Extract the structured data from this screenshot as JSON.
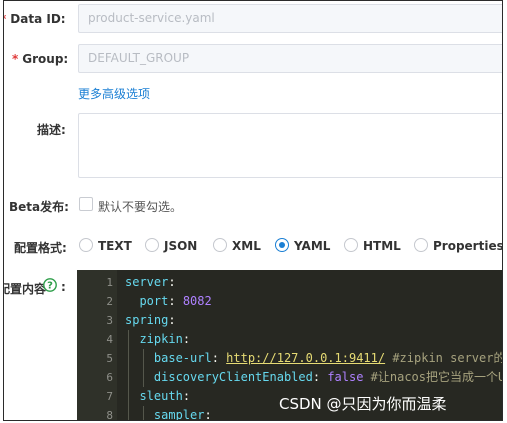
{
  "form": {
    "data_id": {
      "required_mark": "*",
      "label": "Data ID:",
      "value": "product-service.yaml"
    },
    "group": {
      "required_mark": "*",
      "label": "Group:",
      "value": "DEFAULT_GROUP"
    },
    "advanced_link": "更多高级选项",
    "description": {
      "label": "描述:",
      "value": ""
    },
    "beta": {
      "label": "Beta发布:",
      "checkbox_label": "默认不要勾选。",
      "checked": false
    },
    "format": {
      "label": "配置格式:",
      "options": [
        "TEXT",
        "JSON",
        "XML",
        "YAML",
        "HTML",
        "Properties"
      ],
      "selected": "YAML"
    },
    "content": {
      "label": "配置内容",
      "label_suffix": ":",
      "help_icon": "question-circle-icon"
    }
  },
  "editor": {
    "line_numbers": [
      "1",
      "2",
      "3",
      "4",
      "5",
      "6",
      "7",
      "8"
    ],
    "lines": [
      [
        {
          "t": "k",
          "s": "server"
        },
        {
          "t": "p",
          "s": ":"
        }
      ],
      [
        {
          "t": "p",
          "s": "  "
        },
        {
          "t": "k",
          "s": "port"
        },
        {
          "t": "p",
          "s": ": "
        },
        {
          "t": "n",
          "s": "8082"
        }
      ],
      [
        {
          "t": "k",
          "s": "spring"
        },
        {
          "t": "p",
          "s": ":"
        }
      ],
      [
        {
          "t": "p",
          "s": "  "
        },
        {
          "t": "k",
          "s": "zipkin"
        },
        {
          "t": "p",
          "s": ":"
        }
      ],
      [
        {
          "t": "p",
          "s": "    "
        },
        {
          "t": "k",
          "s": "base-url"
        },
        {
          "t": "p",
          "s": ": "
        },
        {
          "t": "u",
          "s": "http://127.0.0.1:9411/"
        },
        {
          "t": "c",
          "s": " #zipkin server的请求地址"
        }
      ],
      [
        {
          "t": "p",
          "s": "    "
        },
        {
          "t": "k",
          "s": "discoveryClientEnabled"
        },
        {
          "t": "p",
          "s": ": "
        },
        {
          "t": "f",
          "s": "false"
        },
        {
          "t": "c",
          "s": " #让nacos把它当成一个URL"
        }
      ],
      [
        {
          "t": "p",
          "s": "  "
        },
        {
          "t": "k",
          "s": "sleuth"
        },
        {
          "t": "p",
          "s": ":"
        }
      ],
      [
        {
          "t": "p",
          "s": "    "
        },
        {
          "t": "k",
          "s": "sampler"
        },
        {
          "t": "p",
          "s": ":"
        }
      ]
    ]
  },
  "watermark": "CSDN @只因为你而温柔",
  "colors": {
    "accent": "#1a7fd4",
    "required": "#e03a3a",
    "editor_bg": "#272822"
  }
}
